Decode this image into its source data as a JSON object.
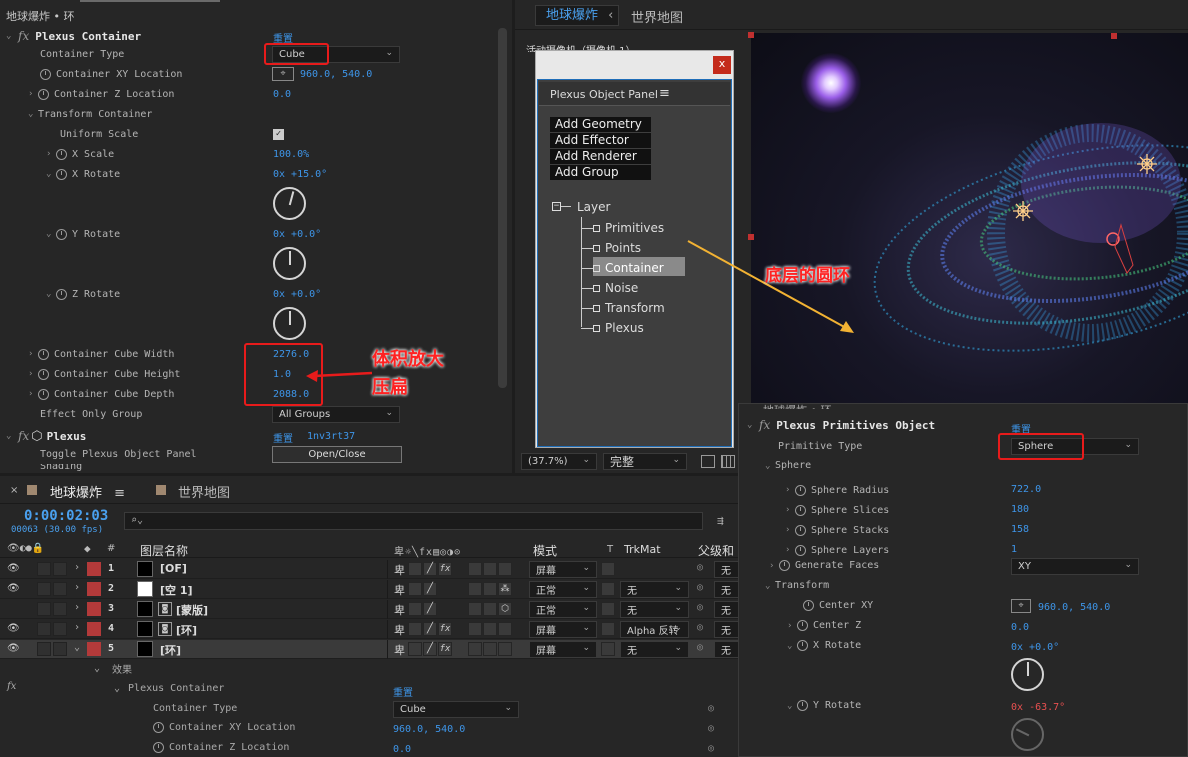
{
  "effect_header": {
    "layer_title": "地球爆炸 • 环"
  },
  "left_panel": {
    "plexus_container": {
      "title": "Plexus Container",
      "reset": "重置"
    },
    "rows": [
      {
        "label": "Container Type",
        "value": "Cube"
      },
      {
        "label": "Container XY Location",
        "value": "960.0, 540.0"
      },
      {
        "label": "Container Z Location",
        "value": "0.0"
      },
      {
        "label": "Transform Container"
      },
      {
        "label": "Uniform Scale"
      },
      {
        "label": "X Scale",
        "value": "100.0%"
      },
      {
        "label": "X Rotate",
        "value": "0x +15.0°"
      },
      {
        "label": "Y Rotate",
        "value": "0x +0.0°"
      },
      {
        "label": "Z Rotate",
        "value": "0x +0.0°"
      },
      {
        "label": "Container Cube Width",
        "value": "2276.0"
      },
      {
        "label": "Container Cube Height",
        "value": "1.0"
      },
      {
        "label": "Container Cube Depth",
        "value": "2088.0"
      },
      {
        "label": "Effect Only Group",
        "value": "All Groups"
      }
    ],
    "plexus": {
      "title": "Plexus",
      "reset": "重置",
      "version": "1nv3rt37"
    },
    "toggle_label": "Toggle Plexus Object Panel",
    "toggle_button": "Open/Close",
    "cut_label": "Shading"
  },
  "annotations": {
    "enlarge": "体积放大",
    "flatten": "压扁",
    "ring": "底层的圆环"
  },
  "viewer": {
    "tab_active": "地球爆炸",
    "tab_active_arrow": "‹",
    "tab_other": "世界地图",
    "camera_label": "活动摄像机（摄像机 1）",
    "zoom": "(37.7%)",
    "quality": "完整"
  },
  "object_panel": {
    "title": "Plexus Object Panel",
    "menu_icon": "≡",
    "close": "x",
    "buttons": [
      "Add Geometry",
      "Add Effector",
      "Add Renderer",
      "Add Group"
    ],
    "tree_root": "Layer",
    "tree_items": [
      "Primitives",
      "Points",
      "Container",
      "Noise",
      "Transform",
      "Plexus"
    ],
    "selected": "Container"
  },
  "timeline": {
    "tab_active": "地球爆炸",
    "menu_icon": "≡",
    "tab_other": "世界地图",
    "timecode": "0:00:02:03",
    "frames": "00063 (30.00 fps)",
    "search_placeholder": "",
    "headers": {
      "num": "#",
      "name": "图层名称",
      "mode": "模式",
      "t": "T",
      "trkmat": "TrkMat",
      "parent": "父级和"
    },
    "layers": [
      {
        "num": "1",
        "name": "[OF]",
        "mode": "屏幕",
        "trkmat": "",
        "parent": "无"
      },
      {
        "num": "2",
        "name": "[空 1]",
        "mode": "正常",
        "trkmat": "无",
        "parent": "无"
      },
      {
        "num": "3",
        "name": "[蒙版]",
        "mode": "正常",
        "trkmat": "无",
        "parent": "无"
      },
      {
        "num": "4",
        "name": "[环]",
        "mode": "屏幕",
        "trkmat": "Alpha 反转",
        "parent": "无"
      },
      {
        "num": "5",
        "name": "[环]",
        "mode": "屏幕",
        "trkmat": "无",
        "parent": "无"
      }
    ],
    "effects_label": "效果",
    "fx_label": "fx",
    "sub": {
      "title": "Plexus Container",
      "reset": "重置",
      "type_label": "Container Type",
      "type_value": "Cube",
      "xy_label": "Container XY Location",
      "xy_value": "960.0, 540.0",
      "z_label": "Container Z Location",
      "z_value": "0.0"
    }
  },
  "primitives_panel": {
    "cut_top": "地球爆炸 • 环",
    "title": "Plexus Primitives Object",
    "reset": "重置",
    "primitive_type_label": "Primitive Type",
    "primitive_type_value": "Sphere",
    "sphere_group": "Sphere",
    "rows": [
      {
        "label": "Sphere Radius",
        "value": "722.0"
      },
      {
        "label": "Sphere Slices",
        "value": "180"
      },
      {
        "label": "Sphere Stacks",
        "value": "158"
      },
      {
        "label": "Sphere Layers",
        "value": "1"
      }
    ],
    "gen_faces_label": "Generate Faces",
    "gen_faces_value": "XY",
    "transform_group": "Transform",
    "center_xy_label": "Center XY",
    "center_xy_value": "960.0, 540.0",
    "center_z_label": "Center Z",
    "center_z_value": "0.0",
    "x_rotate_label": "X Rotate",
    "x_rotate_value": "0x +0.0°",
    "y_rotate_label": "Y Rotate",
    "y_rotate_prefix": "0",
    "y_rotate_value": "x -63.7°"
  }
}
